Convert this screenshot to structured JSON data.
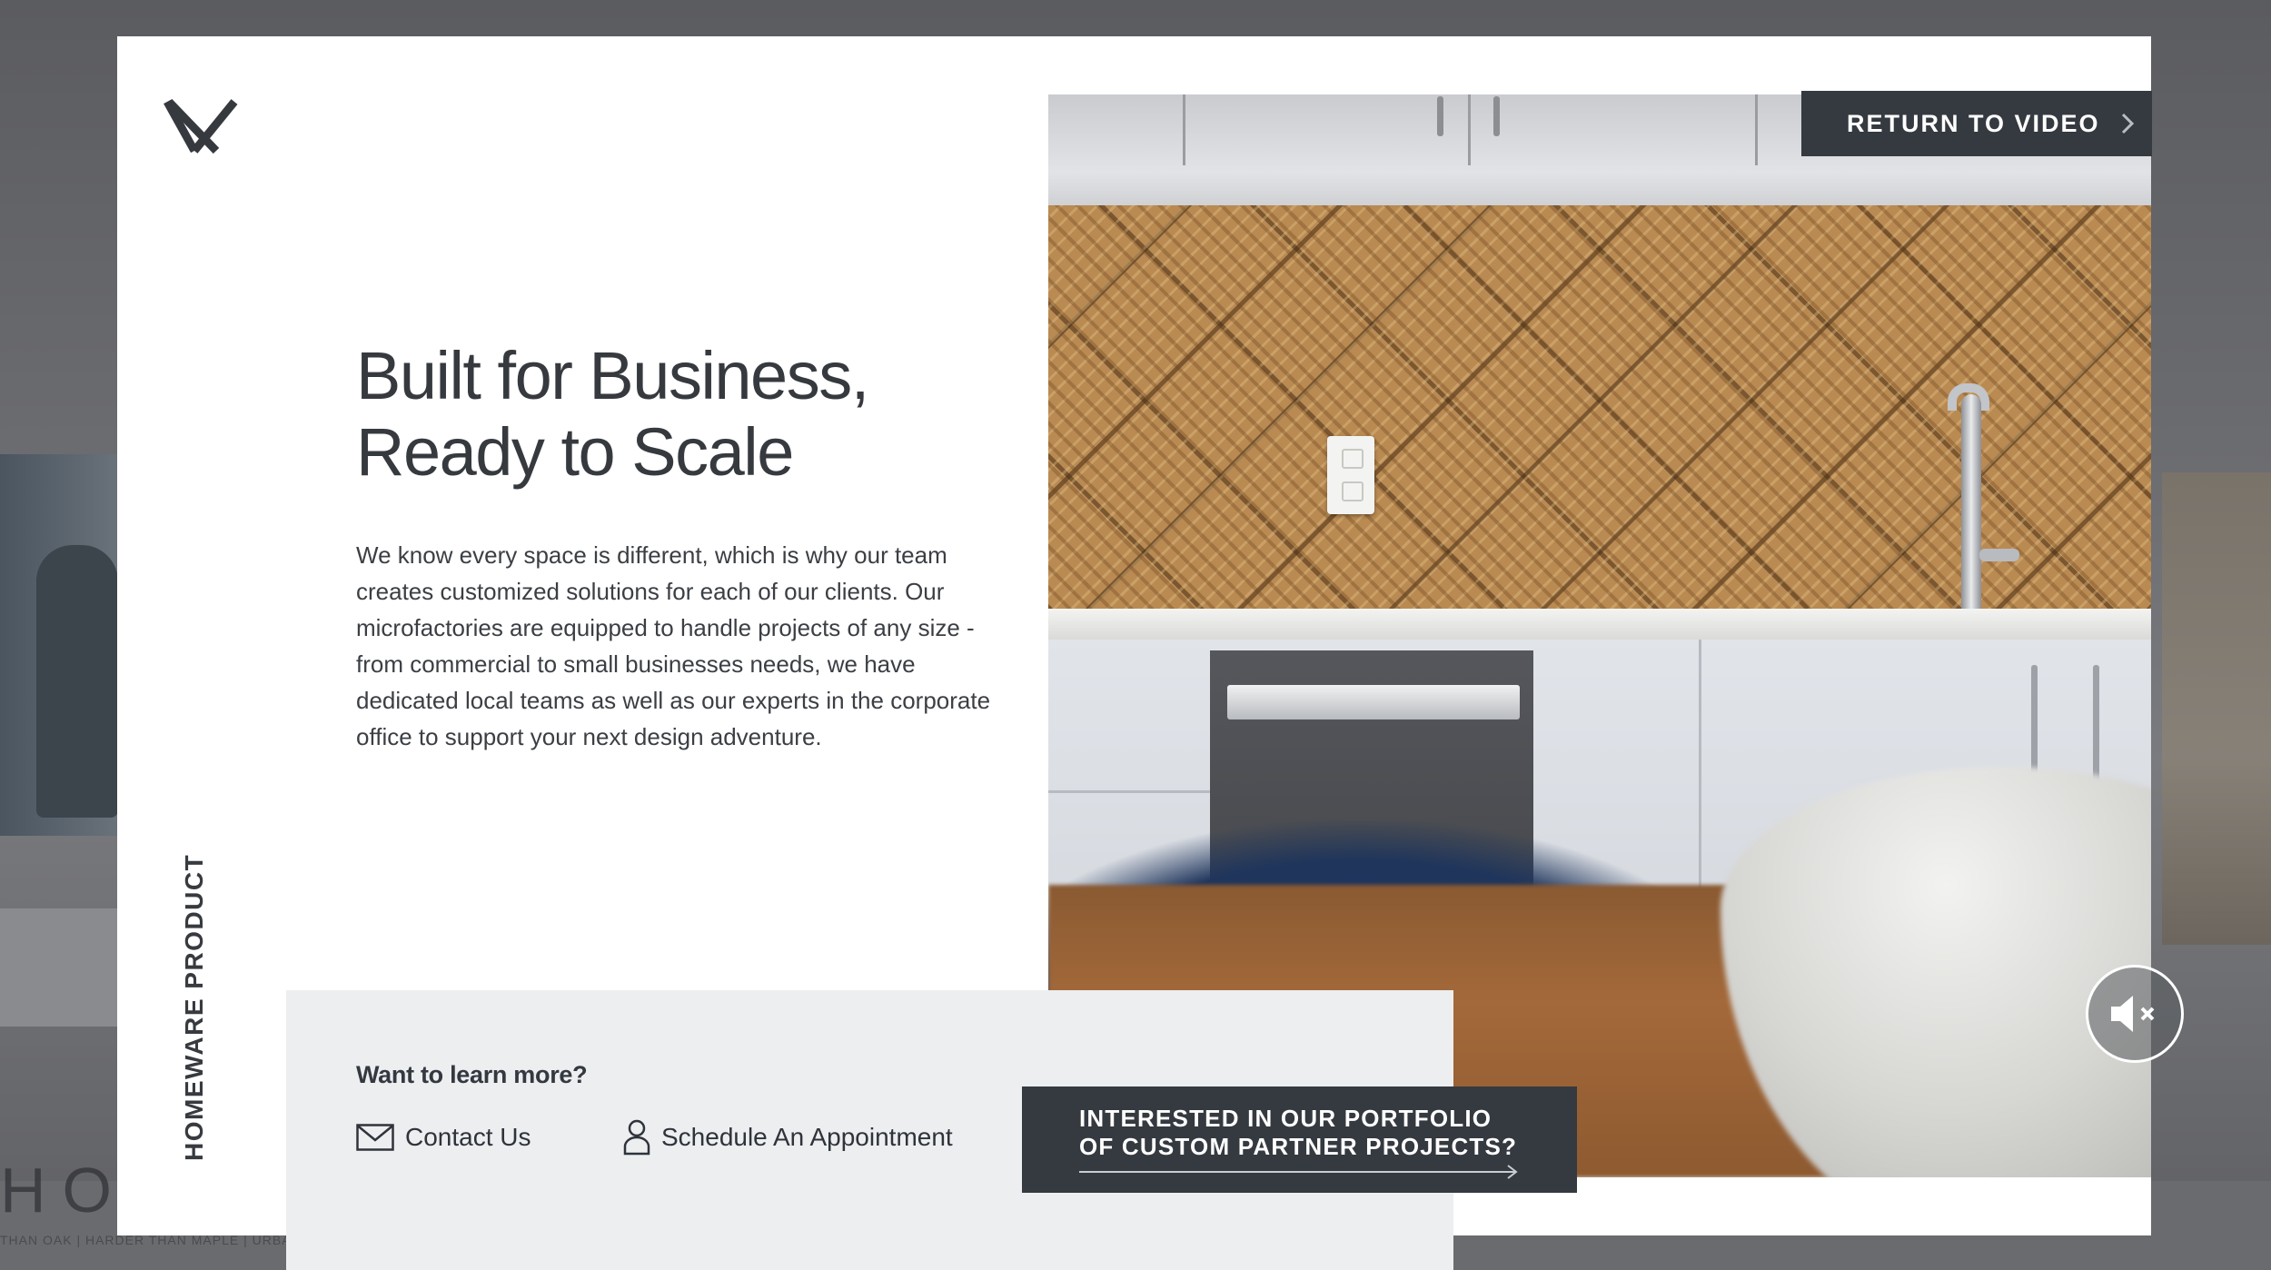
{
  "background": {
    "brand_fragment": "HOF",
    "tagline_fragment": "THAN OAK | HARDER THAN MAPLE | URBAN HARVESTED MATERIAL"
  },
  "modal": {
    "vertical_label": "HOMEWARE PRODUCT",
    "headline_line1": "Built for Business,",
    "headline_line2": "Ready to Scale",
    "body": "We know every space is different, which is why our team creates customized solutions for each of our clients. Our microfactories are equipped to handle projects of any size - from commercial to small businesses needs, we have dedicated local teams as well as our experts in the corporate office to support your next design adventure.",
    "return_button_label": "RETURN TO VIDEO",
    "cta": {
      "prompt": "Want to learn more?",
      "contact_label": "Contact Us",
      "schedule_label": "Schedule An Appointment",
      "portfolio_line1": "INTERESTED IN OUR PORTFOLIO",
      "portfolio_line2": "OF CUSTOM PARTNER PROJECTS?"
    }
  },
  "icons": {
    "close": "close-icon",
    "chevron": "chevron-right-icon",
    "envelope": "envelope-icon",
    "person": "person-icon",
    "arrow": "arrow-right-icon",
    "mute": "speaker-muted-icon"
  },
  "colors": {
    "dark": "#353940",
    "text": "#363a3f",
    "band": "#eceef0",
    "white": "#ffffff"
  }
}
